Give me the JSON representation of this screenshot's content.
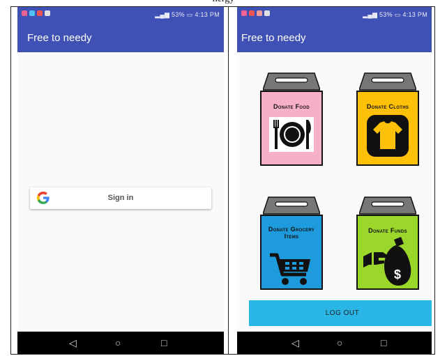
{
  "caption": "nergy",
  "left_screen": {
    "status_time": "4:13 PM",
    "status_battery": "53%",
    "app_title": "Free to needy",
    "signin_label": "Sign in"
  },
  "right_screen": {
    "status_time": "4:13 PM",
    "status_battery": "53%",
    "app_title": "Free to needy",
    "tiles": [
      {
        "label": "Donate Food",
        "color": "#f7b1c6"
      },
      {
        "label": "Donate Cloths",
        "color": "#ffc107"
      },
      {
        "label": "Donate Grocery Items",
        "color": "#1e9bdc"
      },
      {
        "label": "Donate Funds",
        "color": "#9bd62a"
      }
    ],
    "logout_label": "LOG OUT"
  },
  "nav": {
    "back": "◁",
    "home": "○",
    "recents": "□"
  }
}
